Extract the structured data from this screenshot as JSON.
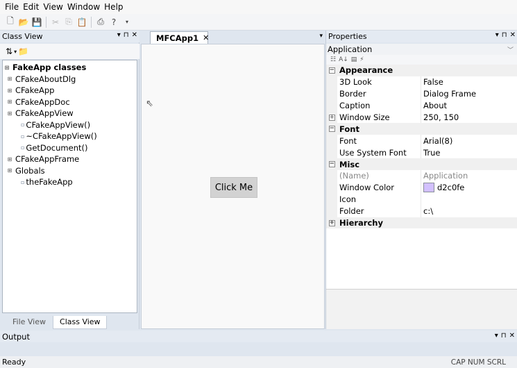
{
  "menu": [
    "File",
    "Edit",
    "View",
    "Window",
    "Help"
  ],
  "toolbar_icons": [
    "new-icon",
    "open-icon",
    "save-icon",
    "cut-icon",
    "copy-icon",
    "paste-icon",
    "print-icon",
    "help-icon"
  ],
  "class_view": {
    "title": "Class View",
    "tree": [
      {
        "label": "FakeApp classes",
        "level": 0,
        "bold": true
      },
      {
        "label": "CFakeAboutDlg",
        "level": 1
      },
      {
        "label": "CFakeApp",
        "level": 1
      },
      {
        "label": "CFakeAppDoc",
        "level": 1
      },
      {
        "label": "CFakeAppView",
        "level": 1
      },
      {
        "label": "CFakeAppView()",
        "level": 2
      },
      {
        "label": "~CFakeAppView()",
        "level": 2
      },
      {
        "label": "GetDocument()",
        "level": 2
      },
      {
        "label": "CFakeAppFrame",
        "level": 1
      },
      {
        "label": "Globals",
        "level": 1
      },
      {
        "label": "theFakeApp",
        "level": 2
      }
    ],
    "tabs": [
      "File View",
      "Class View"
    ]
  },
  "document": {
    "tab_label": "MFCApp1",
    "button_label": "Click Me"
  },
  "properties": {
    "title": "Properties",
    "object": "Application",
    "rows": [
      {
        "type": "category",
        "label": "Appearance",
        "expanded": true
      },
      {
        "type": "prop",
        "name": "3D Look",
        "value": "False"
      },
      {
        "type": "prop",
        "name": "Border",
        "value": "Dialog Frame"
      },
      {
        "type": "prop",
        "name": "Caption",
        "value": "About"
      },
      {
        "type": "prop",
        "name": "Window Size",
        "value": "250, 150",
        "expandable": true
      },
      {
        "type": "category",
        "label": "Font",
        "expanded": true
      },
      {
        "type": "prop",
        "name": "Font",
        "value": "Arial(8)"
      },
      {
        "type": "prop",
        "name": "Use System Font",
        "value": "True"
      },
      {
        "type": "category",
        "label": "Misc",
        "expanded": true
      },
      {
        "type": "prop",
        "name": "(Name)",
        "value": "Application",
        "dim": true
      },
      {
        "type": "prop",
        "name": "Window Color",
        "value": "d2c0fe",
        "swatch": "#d2c0fe"
      },
      {
        "type": "prop",
        "name": "Icon",
        "value": ""
      },
      {
        "type": "prop",
        "name": "Folder",
        "value": "c:\\"
      },
      {
        "type": "category",
        "label": "Hierarchy",
        "expanded": false
      }
    ]
  },
  "output": {
    "title": "Output"
  },
  "status": {
    "left": "Ready",
    "right": "CAP NUM SCRL"
  }
}
